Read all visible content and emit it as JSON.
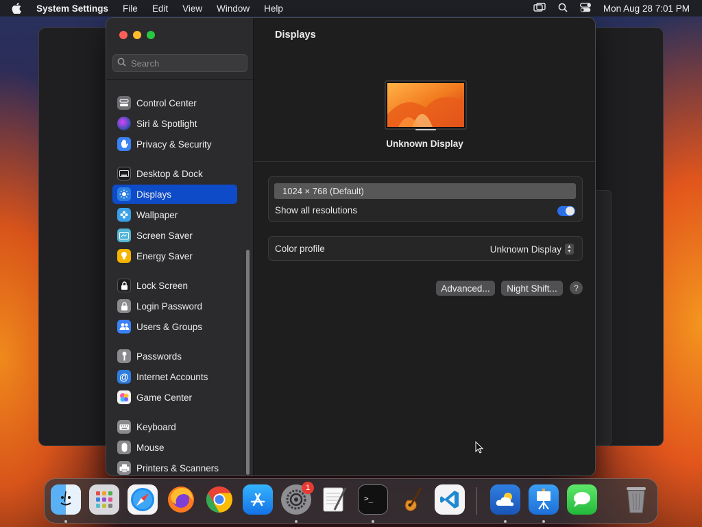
{
  "menubar": {
    "app_name": "System Settings",
    "items": [
      "File",
      "Edit",
      "View",
      "Window",
      "Help"
    ],
    "clock": "Mon Aug 28  7:01 PM"
  },
  "search": {
    "placeholder": "Search"
  },
  "sidebar": {
    "items": [
      {
        "label": "Control Center",
        "icon": "control-center-icon"
      },
      {
        "label": "Siri & Spotlight",
        "icon": "siri-icon"
      },
      {
        "label": "Privacy & Security",
        "icon": "hand-icon"
      },
      {
        "label": "Desktop & Dock",
        "icon": "desktop-dock-icon"
      },
      {
        "label": "Displays",
        "icon": "sun-icon",
        "selected": true
      },
      {
        "label": "Wallpaper",
        "icon": "wallpaper-icon"
      },
      {
        "label": "Screen Saver",
        "icon": "screen-saver-icon"
      },
      {
        "label": "Energy Saver",
        "icon": "bulb-icon"
      },
      {
        "label": "Lock Screen",
        "icon": "lock-icon"
      },
      {
        "label": "Login Password",
        "icon": "lock-icon"
      },
      {
        "label": "Users & Groups",
        "icon": "users-icon"
      },
      {
        "label": "Passwords",
        "icon": "key-icon"
      },
      {
        "label": "Internet Accounts",
        "icon": "at-icon"
      },
      {
        "label": "Game Center",
        "icon": "game-center-icon"
      },
      {
        "label": "Keyboard",
        "icon": "keyboard-icon"
      },
      {
        "label": "Mouse",
        "icon": "mouse-icon"
      },
      {
        "label": "Printers & Scanners",
        "icon": "printer-icon"
      }
    ]
  },
  "content": {
    "title": "Displays",
    "display_name": "Unknown Display",
    "resolution": "1024 × 768 (Default)",
    "show_all_label": "Show all resolutions",
    "show_all_enabled": true,
    "color_profile_label": "Color profile",
    "color_profile_value": "Unknown Display",
    "advanced_button": "Advanced...",
    "night_shift_button": "Night Shift...",
    "help_button": "?"
  },
  "dock": {
    "apps": [
      "Finder",
      "Launchpad",
      "Safari",
      "Firefox",
      "Chrome",
      "App Store",
      "System Settings",
      "TextEdit",
      "Terminal",
      "GarageBand",
      "Visual Studio Code",
      "Weather",
      "Keynote",
      "Messages",
      "Trash"
    ],
    "system_settings_badge": "1"
  },
  "colors": {
    "selection": "#0e4bc9",
    "toggle_on": "#2a6ee8",
    "close": "#ff5f57",
    "minimize": "#febc2e",
    "zoom": "#28c840"
  }
}
